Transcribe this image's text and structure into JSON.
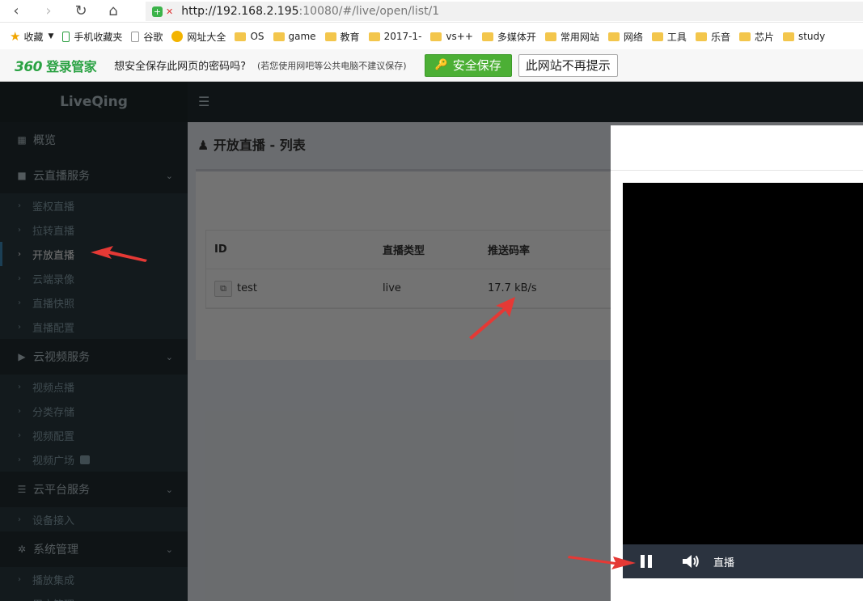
{
  "browser": {
    "back": "‹",
    "forward": "›",
    "refresh": "↻",
    "home": "⌂",
    "url_host": "http://192.168.2.195",
    "url_path": ":10080/#/live/open/list/1"
  },
  "bookmarks": [
    {
      "label": "收藏",
      "icon": "star-icon"
    },
    {
      "label": "手机收藏夹",
      "icon": "phone-icon"
    },
    {
      "label": "谷歌",
      "icon": "page-icon"
    },
    {
      "label": "网址大全",
      "icon": "globe-icon"
    },
    {
      "label": "OS",
      "icon": "folder-icon"
    },
    {
      "label": "game",
      "icon": "folder-icon"
    },
    {
      "label": "教育",
      "icon": "folder-icon"
    },
    {
      "label": "2017-1-",
      "icon": "folder-icon"
    },
    {
      "label": "vs++",
      "icon": "folder-icon"
    },
    {
      "label": "多媒体开",
      "icon": "folder-icon"
    },
    {
      "label": "常用网站",
      "icon": "folder-icon"
    },
    {
      "label": "网络",
      "icon": "folder-icon"
    },
    {
      "label": "工具",
      "icon": "folder-icon"
    },
    {
      "label": "乐音",
      "icon": "folder-icon"
    },
    {
      "label": "芯片",
      "icon": "folder-icon"
    },
    {
      "label": "study",
      "icon": "folder-icon"
    }
  ],
  "password_bar": {
    "logo_num": "360",
    "logo_text": "登录管家",
    "message": "想安全保存此网页的密码吗?",
    "note": "(若您使用网吧等公共电脑不建议保存)",
    "save_label": "安全保存",
    "never_label": "此网站不再提示"
  },
  "app": {
    "brand": "LiveQing",
    "sidebar": [
      {
        "type": "head",
        "label": "概览",
        "icon": "dashboard-icon"
      },
      {
        "type": "head",
        "label": "云直播服务",
        "icon": "video-camera-icon",
        "open": true
      },
      {
        "type": "item",
        "label": "鉴权直播"
      },
      {
        "type": "item",
        "label": "拉转直播"
      },
      {
        "type": "item",
        "label": "开放直播",
        "active": true
      },
      {
        "type": "item",
        "label": "云端录像"
      },
      {
        "type": "item",
        "label": "直播快照"
      },
      {
        "type": "item",
        "label": "直播配置"
      },
      {
        "type": "head",
        "label": "云视频服务",
        "icon": "youtube-play-icon",
        "open": true
      },
      {
        "type": "item",
        "label": "视频点播"
      },
      {
        "type": "item",
        "label": "分类存储"
      },
      {
        "type": "item",
        "label": "视频配置"
      },
      {
        "type": "item",
        "label": "视频广场",
        "external": true
      },
      {
        "type": "head",
        "label": "云平台服务",
        "icon": "server-icon",
        "open": true
      },
      {
        "type": "item",
        "label": "设备接入"
      },
      {
        "type": "head",
        "label": "系统管理",
        "icon": "cog-icon",
        "open": true
      },
      {
        "type": "item",
        "label": "播放集成"
      },
      {
        "type": "item",
        "label": "用户管理"
      }
    ],
    "page_title": "开放直播 - 列表",
    "table": {
      "headers": [
        "ID",
        "直播类型",
        "推送码率"
      ],
      "rows": [
        {
          "id": "test",
          "type": "live",
          "bitrate": "17.7 kB/s"
        }
      ]
    },
    "player": {
      "live_label": "直播"
    }
  },
  "colors": {
    "sidebar_bg": "#222d32",
    "accent": "#3c8dbc",
    "save_green": "#4caf35",
    "annotation_red": "#e53935"
  }
}
